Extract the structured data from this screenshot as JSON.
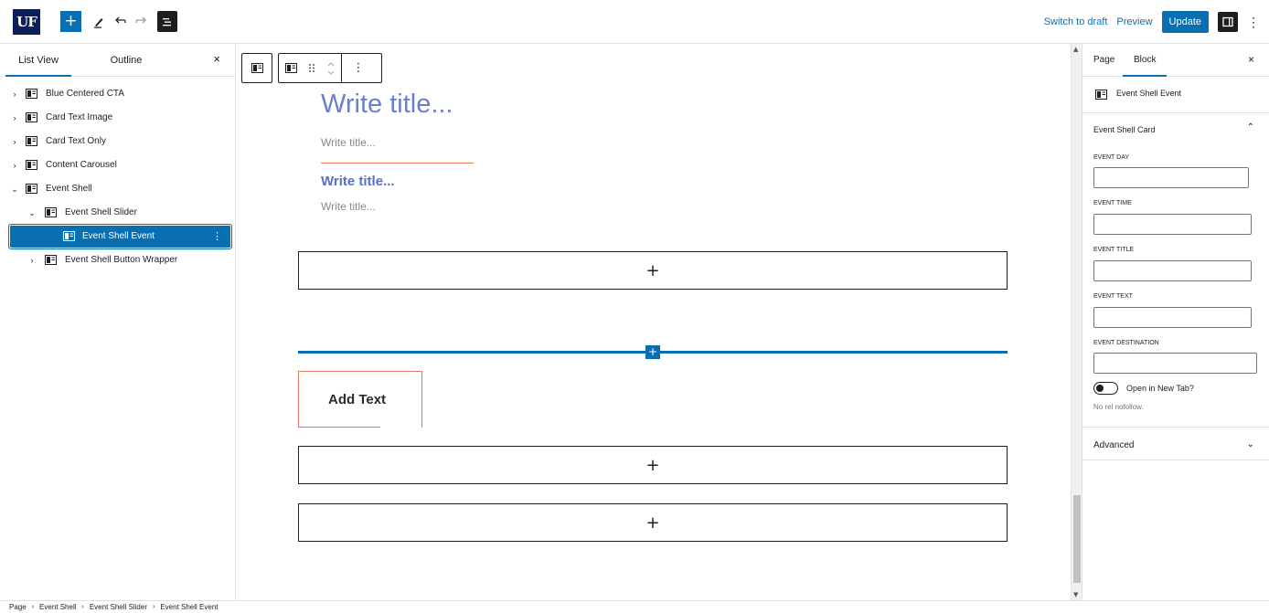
{
  "topbar": {
    "logo": "UF",
    "add_block": "+",
    "switch_draft": "Switch to draft",
    "preview": "Preview",
    "update": "Update"
  },
  "left_sidebar": {
    "tabs": [
      "List View",
      "Outline"
    ],
    "active_tab": "List View",
    "close": "×",
    "tree": [
      {
        "label": "Blue Centered CTA",
        "level": 0,
        "expanded": false
      },
      {
        "label": "Card Text Image",
        "level": 0,
        "expanded": false
      },
      {
        "label": "Card Text Only",
        "level": 0,
        "expanded": false
      },
      {
        "label": "Content Carousel",
        "level": 0,
        "expanded": false
      },
      {
        "label": "Event Shell",
        "level": 0,
        "expanded": true
      },
      {
        "label": "Event Shell Slider",
        "level": 1,
        "expanded": true
      },
      {
        "label": "Event Shell Event",
        "level": 2,
        "selected": true
      },
      {
        "label": "Event Shell Button Wrapper",
        "level": 1,
        "expanded": false
      }
    ]
  },
  "canvas": {
    "title_large": "Write title...",
    "title_small": "Write title...",
    "title_bold": "Write title...",
    "title_small2": "Write title...",
    "appender_plus": "+",
    "add_text": "Add Text"
  },
  "right_sidebar": {
    "tabs": [
      "Page",
      "Block"
    ],
    "active_tab": "Block",
    "close": "×",
    "block_name": "Event Shell Event",
    "panel_title": "Event Shell Card",
    "fields": [
      {
        "label": "EVENT DAY",
        "value": ""
      },
      {
        "label": "EVENT TIME",
        "value": ""
      },
      {
        "label": "EVENT TITLE",
        "value": ""
      },
      {
        "label": "EVENT TEXT",
        "value": ""
      },
      {
        "label": "EVENT DESTINATION",
        "value": ""
      }
    ],
    "toggle_label": "Open in New Tab?",
    "toggle_on": false,
    "help_text": "No rel nofollow.",
    "advanced": "Advanced"
  },
  "breadcrumb": [
    "Page",
    "Event Shell",
    "Event Shell Slider",
    "Event Shell Event"
  ],
  "colors": {
    "accent": "#0a6fb0",
    "title_blue": "#6b7fd0",
    "orange": "#e07a5f",
    "logo_bg": "#0b1f5c"
  }
}
